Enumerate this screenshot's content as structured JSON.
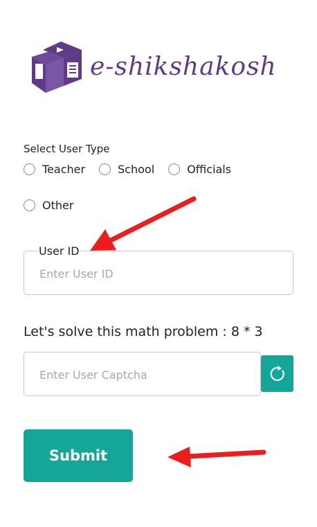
{
  "brand": {
    "name": "e-shikshakosh"
  },
  "user_type": {
    "label": "Select User Type",
    "options": [
      "Teacher",
      "School",
      "Officials",
      "Other"
    ],
    "selected": null
  },
  "user_id": {
    "legend": "User ID",
    "placeholder": "Enter User ID",
    "value": ""
  },
  "captcha": {
    "question": "Let's solve this math problem : 8 * 3",
    "placeholder": "Enter User Captcha",
    "value": "",
    "refresh_icon": "refresh-icon"
  },
  "submit": {
    "label": "Submit"
  },
  "annotations": {
    "arrow_color": "#ee1c1c",
    "count": 2
  },
  "colors": {
    "accent": "#14a698",
    "brand": "#5f3b87"
  }
}
